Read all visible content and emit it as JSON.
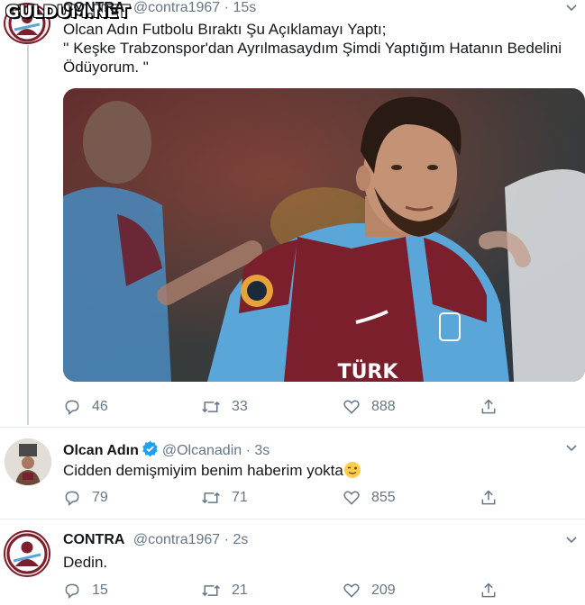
{
  "watermark": "GULDUM.NET",
  "tweets": [
    {
      "name": "CONTRA",
      "handle": "@contra1967",
      "dot": "·",
      "time": "15s",
      "text": [
        "Olcan Adın Futbolu Bıraktı Şu Açıklamayı Yaptı;",
        "'' Keşke Trabzonspor'dan Ayrılmasaydım Şimdi Yaptığım Hatanın Bedelini",
        "Ödüyorum. \""
      ],
      "photo_text": "TÜRK",
      "replies": "46",
      "retweets": "33",
      "likes": "888"
    },
    {
      "name": "Olcan Adın",
      "handle": "@Olcanadin",
      "dot": "·",
      "time": "3s",
      "text": "Cidden demişmiyim benim haberim yokta",
      "replies": "79",
      "retweets": "71",
      "likes": "855"
    },
    {
      "name": "CONTRA",
      "handle": "@contra1967",
      "dot": "·",
      "time": "2s",
      "text": "Dedin.",
      "replies": "15",
      "retweets": "21",
      "likes": "209"
    }
  ],
  "colors": {
    "accent": "#1da1f2",
    "text": "#14171a",
    "muted": "#657786",
    "trabzon_claret": "#7a1f2b",
    "trabzon_blue": "#5aa6d8"
  },
  "icons": [
    "reply-icon",
    "retweet-icon",
    "like-icon",
    "share-icon",
    "chevron-down-icon",
    "verified-badge-icon",
    "winking-face-emoji"
  ]
}
